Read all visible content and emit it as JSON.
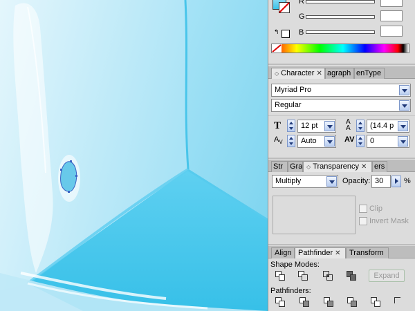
{
  "colors": {
    "accent_blue": "#3a62c4",
    "ice_light": "#cfeffb",
    "ice_dark": "#3ac3e8",
    "panel_bg": "#dcdcdc"
  },
  "canvas": {
    "icons": [
      "ice-cube-artwork",
      "anchor-point-path"
    ]
  },
  "color_panel": {
    "channels": [
      {
        "label": "R"
      },
      {
        "label": "G"
      },
      {
        "label": "B"
      }
    ]
  },
  "character_panel": {
    "tabs": [
      {
        "label": "Character"
      },
      {
        "label": "agraph"
      },
      {
        "label": "enType"
      }
    ],
    "font_family": "Myriad Pro",
    "font_style": "Regular",
    "font_size": "12 pt",
    "leading": "(14.4 p",
    "kerning": "Auto",
    "tracking": "0"
  },
  "transparency_panel": {
    "tabs": [
      {
        "label": "Str"
      },
      {
        "label": "Gra"
      },
      {
        "label": "Transparency"
      },
      {
        "label": "ers"
      }
    ],
    "blend_mode": "Multiply",
    "opacity_label": "Opacity:",
    "opacity_value": "30",
    "opacity_unit": "%",
    "clip_label": "Clip",
    "invert_mask_label": "Invert Mask"
  },
  "pathfinder_panel": {
    "tabs": [
      {
        "label": "Align"
      },
      {
        "label": "Pathfinder"
      },
      {
        "label": "Transform"
      }
    ],
    "shape_modes_label": "Shape Modes:",
    "expand_label": "Expand",
    "pathfinders_label": "Pathfinders:"
  }
}
